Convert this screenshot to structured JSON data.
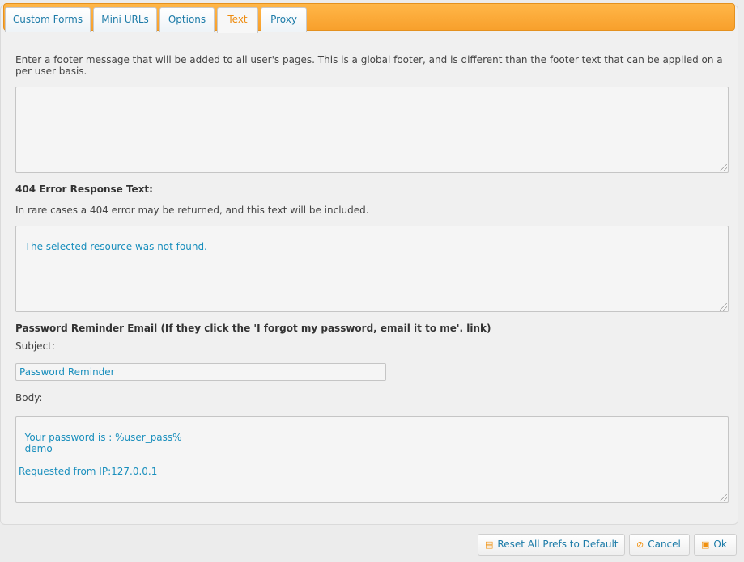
{
  "tabs": [
    {
      "label": "Custom Forms"
    },
    {
      "label": "Mini URLs"
    },
    {
      "label": "Options"
    },
    {
      "label": "Text",
      "active": true
    },
    {
      "label": "Proxy"
    }
  ],
  "footer": {
    "description": "Enter a footer message that will be added to all user's pages. This is a global footer, and is different than the footer text that can be applied on a per user basis.",
    "value": ""
  },
  "error404": {
    "heading": "404 Error Response Text:",
    "description": "In rare cases a 404 error may be returned, and this text will be included.",
    "value": "The selected resource was not found."
  },
  "password_reminder": {
    "heading": "Password Reminder Email (If they click the 'I forgot my password, email it to me'. link)",
    "subject_label": "Subject:",
    "subject_value": "Password Reminder",
    "body_label": "Body:",
    "body_value": "Your password is : %user_pass%\n  demo\n\nRequested from IP:127.0.0.1"
  },
  "buttons": {
    "reset": "Reset All Prefs to Default",
    "cancel": "Cancel",
    "ok": "Ok"
  },
  "icons": {
    "reset": "folder-icon",
    "cancel": "cancel-icon",
    "ok": "save-icon"
  },
  "colors": {
    "accent_orange": "#f8a02c",
    "link_blue": "#1c7ba8",
    "value_blue": "#1a8fbd",
    "active_tab_text": "#ee8c0f"
  }
}
